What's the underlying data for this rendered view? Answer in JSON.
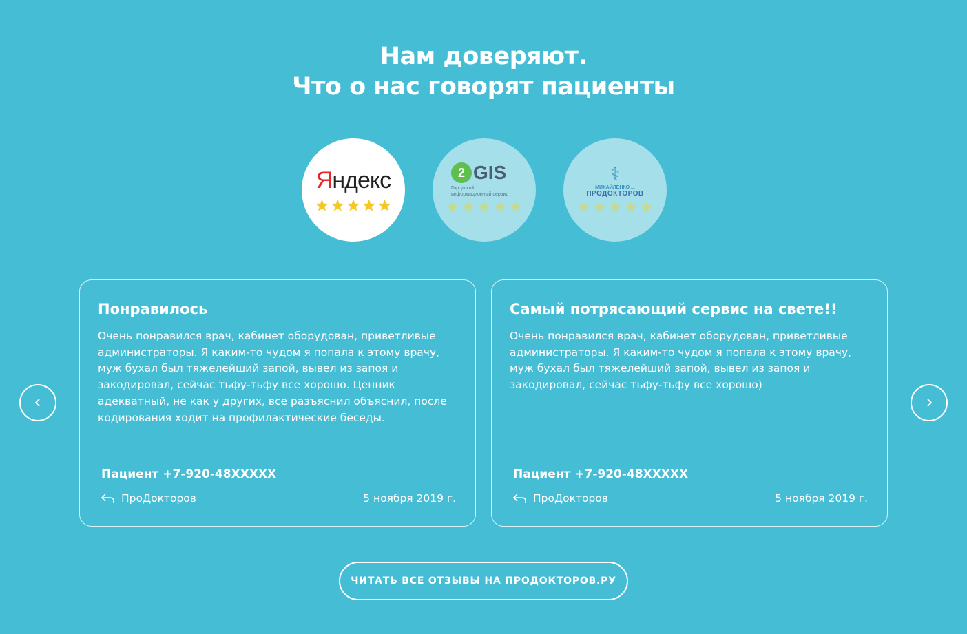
{
  "header": {
    "title_line1": "Нам доверяют.",
    "title_line2": "Что о нас говорят пациенты"
  },
  "badges": [
    {
      "name": "Яндекс",
      "logo_text_first": "Я",
      "logo_text_rest": "ндекс",
      "rating_stars": 5,
      "active": true
    },
    {
      "name": "2GIS",
      "logo_circle": "2",
      "logo_text": "GIS",
      "subtitle_line1": "Городской",
      "subtitle_line2": "информационный сервис",
      "rating_stars": 5,
      "active": false
    },
    {
      "name": "ПроДокторов",
      "top_text": "МИХАЙЛЕНКО ...",
      "logo_text": "ПРОДОКТОРОВ",
      "rating_stars": 5,
      "active": false
    }
  ],
  "reviews": [
    {
      "title": "Понравилось",
      "text": "Очень понравился врач, кабинет оборудован, приветливые администраторы. Я каким-то чудом я попала к этому врачу, муж бухал был тяжелейший запой, вывел из запоя и закодировал, сейчас тьфу-тьфу все хорошо. Ценник адекватный, не как у других, все разъяснил объяснил, после кодирования ходит на профилактические беседы.",
      "author": "Пациент +7-920-48XXXXX",
      "source": "ПроДокторов",
      "date": "5 ноября 2019 г."
    },
    {
      "title": "Самый потрясающий сервис на свете!!",
      "text": "Очень понравился врач, кабинет оборудован, приветливые администраторы. Я каким-то чудом я попала к этому врачу, муж бухал был тяжелейший запой, вывел из запоя и закодировал, сейчас тьфу-тьфу все хорошо)",
      "author": "Пациент +7-920-48XXXXX",
      "source": "ПроДокторов",
      "date": "5 ноября 2019 г."
    }
  ],
  "navigation": {
    "prev_icon": "chevron-left-icon",
    "next_icon": "chevron-right-icon"
  },
  "cta": {
    "label": "ЧИТАТЬ ВСЕ ОТЗЫВЫ НА ПРОДОКТОРОВ.РУ"
  },
  "colors": {
    "background": "#45bdd5",
    "text": "#ffffff",
    "badge_inactive": "#a5dfea",
    "star": "#f6c71d"
  }
}
